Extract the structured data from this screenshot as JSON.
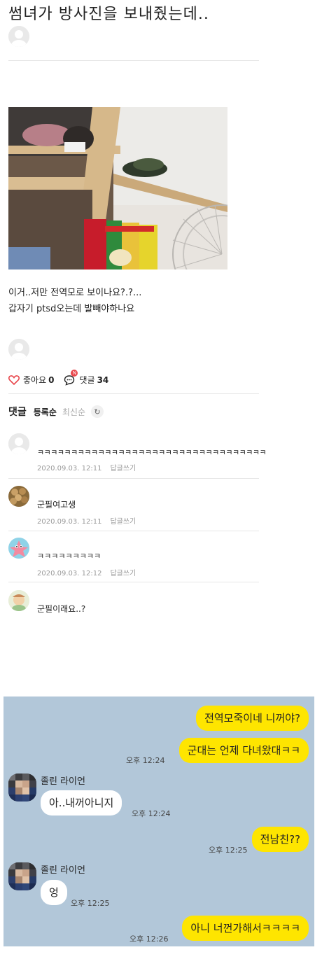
{
  "post": {
    "title": "썸녀가 방사진을 보내줬는데..",
    "body_line1": "이거..저만 전역모로 보이나요?.?...",
    "body_line2": "갑자기 ptsd오는데 발빼야하나요"
  },
  "reactions": {
    "like_label": "좋아요",
    "like_count": "0",
    "comment_label": "댓글",
    "comment_count": "34",
    "comment_badge": "N"
  },
  "comments_header": {
    "title": "댓글",
    "sort_registered": "등록순",
    "sort_latest": "최신순",
    "refresh_icon": "refresh-icon"
  },
  "comments": [
    {
      "text": "ㅋㅋㅋㅋㅋㅋㅋㅋㅋㅋㅋㅋㅋㅋㅋㅋㅋㅋㅋㅋㅋㅋㅋㅋㅋㅋㅋㅋㅋㅋㅋㅋㅋㅋ",
      "date": "2020.09.03. 12:11",
      "reply": "답글쓰기"
    },
    {
      "text": "군필여고생",
      "date": "2020.09.03. 12:11",
      "reply": "답글쓰기"
    },
    {
      "text": "ㅋㅋㅋㅋㅋㅋㅋㅋㅋ",
      "date": "2020.09.03. 12:12",
      "reply": "답글쓰기"
    },
    {
      "text": "군필이래요..?"
    }
  ],
  "chat": {
    "messages": [
      {
        "from": "me",
        "text": "전역모죽이네 니꺼야?"
      },
      {
        "from": "me",
        "text": "군대는 언제 다녀왔대ㅋㅋ",
        "time": "오후 12:24"
      },
      {
        "from": "them",
        "name": "졸린 라이언",
        "text": "아..내꺼아니지",
        "time": "오후 12:24"
      },
      {
        "from": "me",
        "text": "전남친??",
        "time": "오후 12:25"
      },
      {
        "from": "them",
        "name": "졸린 라이언",
        "text": "엉",
        "time": "오후 12:25"
      },
      {
        "from": "me",
        "text": "아니 너껀가해서ㅋㅋㅋㅋ",
        "time": "오후 12:26"
      }
    ]
  },
  "colors": {
    "chat_bg": "#b2c7d9",
    "my_bubble": "#fee500",
    "their_bubble": "#ffffff",
    "heart": "#e8474c"
  }
}
